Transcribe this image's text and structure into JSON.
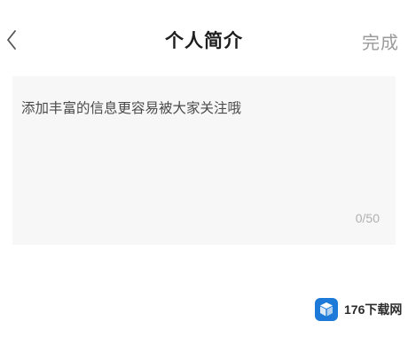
{
  "header": {
    "back_icon": "chevron-left-icon",
    "title": "个人简介",
    "done_label": "完成"
  },
  "bio": {
    "placeholder": "添加丰富的信息更容易被大家关注哦",
    "counter": "0/50"
  },
  "watermark": {
    "text": "176下载网",
    "logo_icon": "cube-logo-icon",
    "logo_color": "#1e7ad8"
  },
  "colors": {
    "background": "#ffffff",
    "input_background": "#f7f7f7",
    "title": "#1e1e1e",
    "done": "#9b9b9b",
    "placeholder": "#4a4a4a",
    "counter": "#b0b0b0"
  }
}
